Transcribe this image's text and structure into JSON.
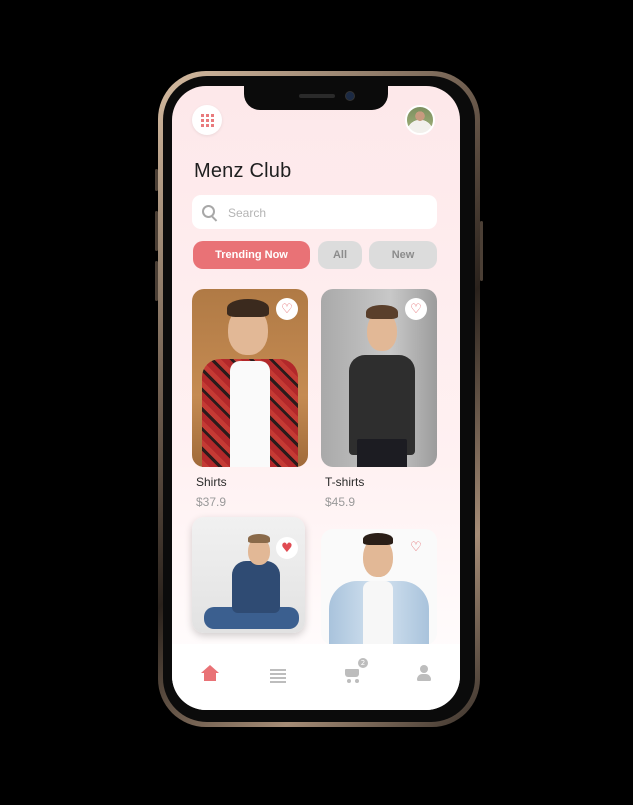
{
  "app": {
    "title": "Menz Club"
  },
  "search": {
    "placeholder": "Search"
  },
  "filters": [
    {
      "label": "Trending Now",
      "active": true
    },
    {
      "label": "All",
      "active": false
    },
    {
      "label": "New",
      "active": false
    }
  ],
  "products": [
    {
      "name": "Shirts",
      "price": "$37.9",
      "favorite": false
    },
    {
      "name": "T-shirts",
      "price": "$45.9",
      "favorite": false
    },
    {
      "favorite": true
    },
    {
      "favorite": false
    }
  ],
  "icons": {
    "favorite_outline": "heart-outline-icon",
    "favorite_filled": "heart-filled-icon",
    "menu": "grid-menu-icon",
    "home": "home-icon",
    "list": "list-icon",
    "cart": "cart-icon",
    "profile": "profile-icon"
  },
  "bottom_nav": {
    "cart_badge": "2",
    "active": "home"
  },
  "colors": {
    "accent": "#e97276",
    "chip_inactive": "#dcdcdc",
    "background": "#fde8ea"
  }
}
